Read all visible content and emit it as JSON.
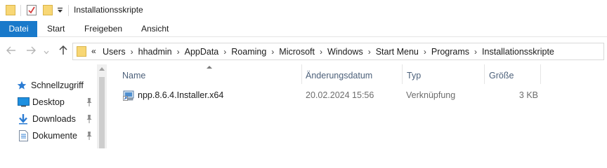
{
  "window": {
    "title": "Installationsskripte"
  },
  "ribbon": {
    "tabs": [
      "Datei",
      "Start",
      "Freigeben",
      "Ansicht"
    ]
  },
  "address": {
    "overflow": "«",
    "path": [
      "Users",
      "hhadmin",
      "AppData",
      "Roaming",
      "Microsoft",
      "Windows",
      "Start Menu",
      "Programs",
      "Installationsskripte"
    ]
  },
  "navigation": {
    "items": [
      {
        "label": "Schnellzugriff",
        "icon": "star-icon",
        "pinned": false
      },
      {
        "label": "Desktop",
        "icon": "desktop-icon",
        "pinned": true
      },
      {
        "label": "Downloads",
        "icon": "download-icon",
        "pinned": true
      },
      {
        "label": "Dokumente",
        "icon": "document-icon",
        "pinned": true
      }
    ]
  },
  "columns": {
    "name": "Name",
    "date": "Änderungsdatum",
    "type": "Typ",
    "size": "Größe"
  },
  "files": [
    {
      "name": "npp.8.6.4.Installer.x64",
      "date": "20.02.2024 15:56",
      "type": "Verknüpfung",
      "size": "3 KB",
      "icon": "shortcut-installer-icon"
    }
  ],
  "colors": {
    "accent": "#1979ca",
    "folder": "#f8d775",
    "header_text": "#4c607a"
  }
}
